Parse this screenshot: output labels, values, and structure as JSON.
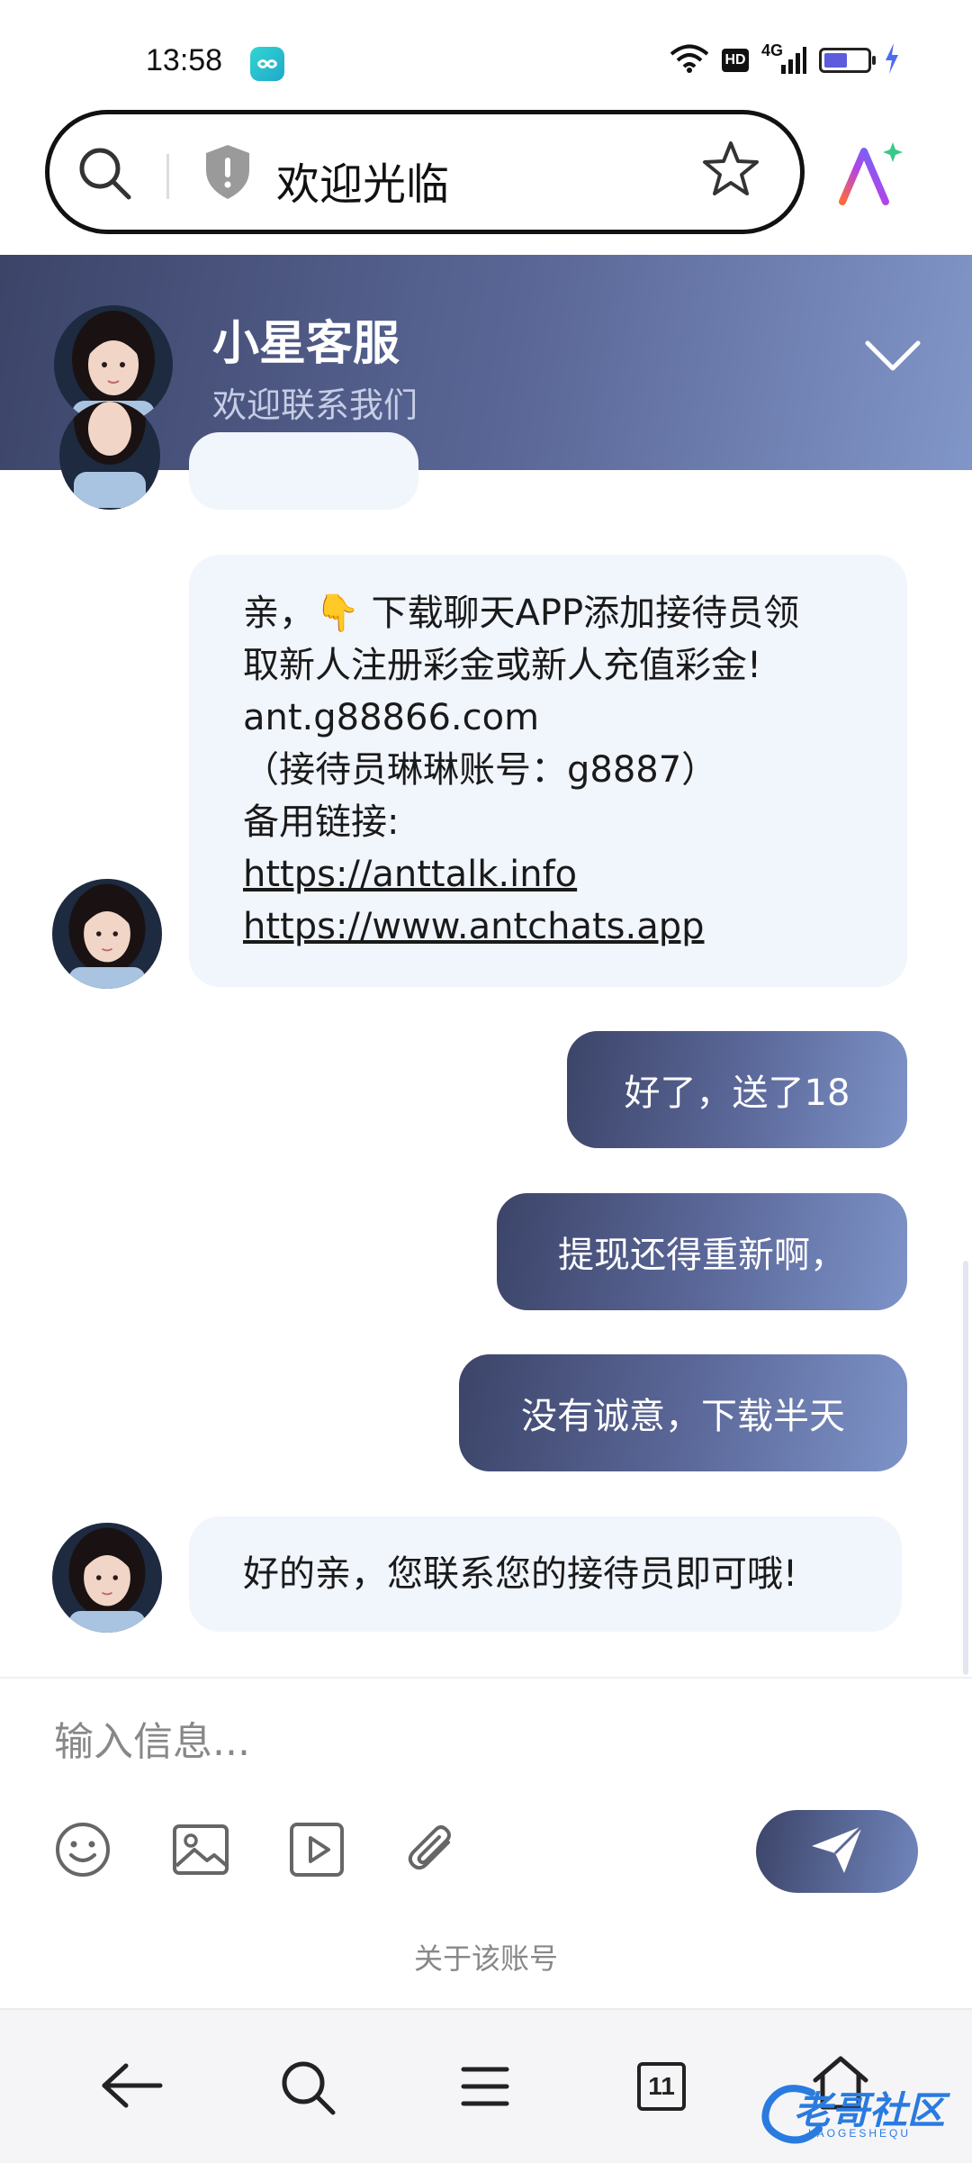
{
  "status_bar": {
    "time": "13:58",
    "hd": "HD",
    "network": "4G",
    "battery_level": 0.6
  },
  "browser": {
    "title": "欢迎光临",
    "icons": [
      "search-icon",
      "shield-icon",
      "star-icon",
      "ai-icon"
    ]
  },
  "chat_header": {
    "title": "小星客服",
    "subtitle": "欢迎联系我们"
  },
  "messages": [
    {
      "from": "agent",
      "lines": [
        "亲，👇 下载聊天APP添加接待员领",
        "取新人注册彩金或新人充值彩金!",
        "ant.g88866.com",
        "（接待员琳琳账号：g8887）",
        "备用链接:",
        "https://anttalk.info",
        "https://www.antchats.app"
      ]
    },
    {
      "from": "user",
      "text": "好了，送了18"
    },
    {
      "from": "user",
      "text": "提现还得重新啊，"
    },
    {
      "from": "user",
      "text": "没有诚意，下载半天"
    },
    {
      "from": "agent",
      "text": "好的亲，您联系您的接待员即可哦!"
    }
  ],
  "composer": {
    "placeholder": "输入信息..."
  },
  "about_link": "关于该账号",
  "bottom_nav": {
    "tab_count": "11"
  },
  "watermark": {
    "text": "老哥社区",
    "sub": "LAOGESHEQU"
  },
  "colors": {
    "header_dark": "#3c4468",
    "header_light": "#8196c8",
    "bubble_in": "#f1f5fc"
  }
}
